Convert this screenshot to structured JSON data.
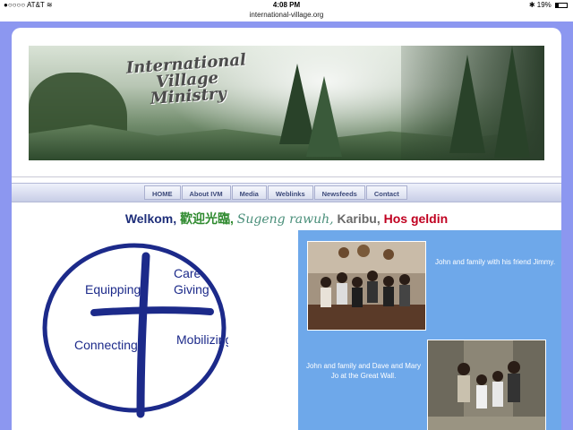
{
  "statusbar": {
    "carrier": "●○○○○ AT&T",
    "wifi": "≋",
    "time": "4:08 PM",
    "bluetooth": "✱",
    "battery": "19%"
  },
  "browser": {
    "url": "international-village.org"
  },
  "banner": {
    "title_line1": "International",
    "title_line2": "Village",
    "title_line3": "Ministry"
  },
  "nav": {
    "items": [
      {
        "label": "HOME"
      },
      {
        "label": "About IVM"
      },
      {
        "label": "Media"
      },
      {
        "label": "Weblinks"
      },
      {
        "label": "Newsfeeds"
      },
      {
        "label": "Contact"
      }
    ]
  },
  "welcome": {
    "w1": "Welkom,",
    "w2": "歡迎光臨,",
    "w3": "Sugeng rawuh,",
    "w4": "Karibu,",
    "w5": "Hos geldin",
    "colors": {
      "w1": "#1f2f7a",
      "w2": "#2f8a2f",
      "w3": "#4a8f7a",
      "w4": "#6a6a6a",
      "w5": "#c00020"
    }
  },
  "logo": {
    "equipping": "Equipping",
    "care": "Care",
    "giving": "Giving",
    "connecting": "Connecting",
    "mobilizing": "Mobilizing"
  },
  "panel": {
    "caption1": "John and family with his friend Jimmy.",
    "caption2": "John and family and Dave and Mary Jo at the Great Wall."
  }
}
